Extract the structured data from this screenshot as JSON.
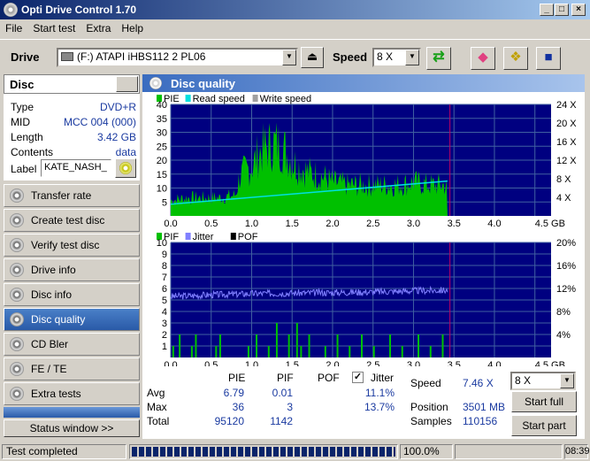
{
  "window": {
    "title": "Opti Drive Control 1.70"
  },
  "menu": [
    "File",
    "Start test",
    "Extra",
    "Help"
  ],
  "toolbar": {
    "drive_label": "Drive",
    "drive_value": "(F:)   ATAPI iHBS112   2 PL06",
    "speed_label": "Speed",
    "speed_value": "8 X"
  },
  "disc": {
    "header": "Disc",
    "rows": [
      {
        "k": "Type",
        "v": "DVD+R"
      },
      {
        "k": "MID",
        "v": "MCC 004 (000)"
      },
      {
        "k": "Length",
        "v": "3.42 GB"
      },
      {
        "k": "Contents",
        "v": "data"
      }
    ],
    "label_key": "Label",
    "label_value": "KATE_NASH_"
  },
  "nav": [
    "Transfer rate",
    "Create test disc",
    "Verify test disc",
    "Drive info",
    "Disc info",
    "Disc quality",
    "CD Bler",
    "FE / TE",
    "Extra tests"
  ],
  "nav_active": 5,
  "status_window_btn": "Status window >>",
  "panel": {
    "title": "Disc quality"
  },
  "chart_data": [
    {
      "type": "area",
      "legend": [
        {
          "name": "PIE",
          "color": "#00c000"
        },
        {
          "name": "Read speed",
          "color": "#00e0e0"
        },
        {
          "name": "Write speed",
          "color": "#a0a0a0"
        }
      ],
      "yticks_left": [
        "40",
        "35",
        "30",
        "25",
        "20",
        "15",
        "10",
        "5"
      ],
      "yticks_right": [
        "24 X",
        "20 X",
        "16 X",
        "12 X",
        "8 X",
        "4 X"
      ],
      "xticks": [
        "0.0",
        "0.5",
        "1.0",
        "1.5",
        "2.0",
        "2.5",
        "3.0",
        "3.5",
        "4.0",
        "4.5 GB"
      ],
      "xlim": [
        0,
        4.7
      ],
      "ylim": [
        0,
        40
      ],
      "series": [
        {
          "name": "PIE",
          "x": [
            0.0,
            0.2,
            0.4,
            0.6,
            0.8,
            0.85,
            0.9,
            1.0,
            1.1,
            1.2,
            1.3,
            1.4,
            1.5,
            1.6,
            1.7,
            1.8,
            1.9,
            2.0,
            2.2,
            2.4,
            2.6,
            2.8,
            3.0,
            3.2,
            3.4,
            3.42
          ],
          "values": [
            6,
            7,
            7,
            7,
            8,
            15,
            17,
            19,
            25,
            27,
            28,
            26,
            21,
            19,
            17,
            16,
            15,
            13,
            12,
            12,
            12,
            12,
            13,
            12,
            12,
            10
          ]
        },
        {
          "name": "Read speed",
          "x": [
            0.0,
            3.42
          ],
          "values": [
            4.2,
            12.5
          ]
        }
      ],
      "marker_x": 3.45
    },
    {
      "type": "area",
      "legend": [
        {
          "name": "PIF",
          "color": "#00c000"
        },
        {
          "name": "Jitter",
          "color": "#8080ff"
        },
        {
          "name": "POF",
          "color": "#000000"
        }
      ],
      "yticks_left": [
        "10",
        "9",
        "8",
        "7",
        "6",
        "5",
        "4",
        "3",
        "2",
        "1"
      ],
      "yticks_right": [
        "20%",
        "16%",
        "12%",
        "8%",
        "4%"
      ],
      "xticks": [
        "0.0",
        "0.5",
        "1.0",
        "1.5",
        "2.0",
        "2.5",
        "3.0",
        "3.5",
        "4.0",
        "4.5 GB"
      ],
      "xlim": [
        0,
        4.7
      ],
      "ylim": [
        0,
        10
      ],
      "series": [
        {
          "name": "Jitter",
          "x": [
            0.0,
            0.5,
            1.0,
            1.5,
            2.0,
            2.5,
            3.0,
            3.42
          ],
          "values": [
            10.6,
            10.9,
            11.1,
            11.2,
            11.3,
            11.4,
            11.6,
            11.7
          ]
        },
        {
          "name": "PIF",
          "x": [
            0.02,
            0.1,
            0.25,
            0.3,
            0.55,
            0.6,
            0.95,
            1.05,
            1.2,
            1.3,
            1.45,
            1.55,
            1.6,
            1.7,
            1.9,
            2.05,
            2.2,
            2.35,
            2.5,
            2.7,
            2.85,
            3.05,
            3.2,
            3.35
          ],
          "values": [
            1,
            2,
            1,
            2,
            1,
            2,
            1,
            2,
            1,
            3,
            2,
            3,
            1,
            2,
            1,
            2,
            1,
            2,
            1,
            2,
            1,
            2,
            1,
            2
          ]
        }
      ],
      "marker_x": 3.45
    }
  ],
  "stats": {
    "headers": [
      "PIE",
      "PIF",
      "POF"
    ],
    "jitter_label": "Jitter",
    "rows": [
      {
        "label": "Avg",
        "pie": "6.79",
        "pif": "0.01",
        "jitter": "11.1%"
      },
      {
        "label": "Max",
        "pie": "36",
        "pif": "3",
        "jitter": "13.7%"
      },
      {
        "label": "Total",
        "pie": "95120",
        "pif": "1142",
        "jitter": ""
      }
    ],
    "speed_label": "Speed",
    "speed_value": "7.46 X",
    "position_label": "Position",
    "position_value": "3501 MB",
    "samples_label": "Samples",
    "samples_value": "110156",
    "speed_select": "8 X",
    "start_full": "Start full",
    "start_part": "Start part"
  },
  "status": {
    "text": "Test completed",
    "progress": "100.0%",
    "progress_value": 1.0,
    "time": "08:39"
  },
  "colors": {
    "plot_bg": "#000080",
    "grid": "#4060a0",
    "pie": "#00c000",
    "read": "#00e0e0",
    "jitter": "#8080ff",
    "marker": "#c00060"
  }
}
